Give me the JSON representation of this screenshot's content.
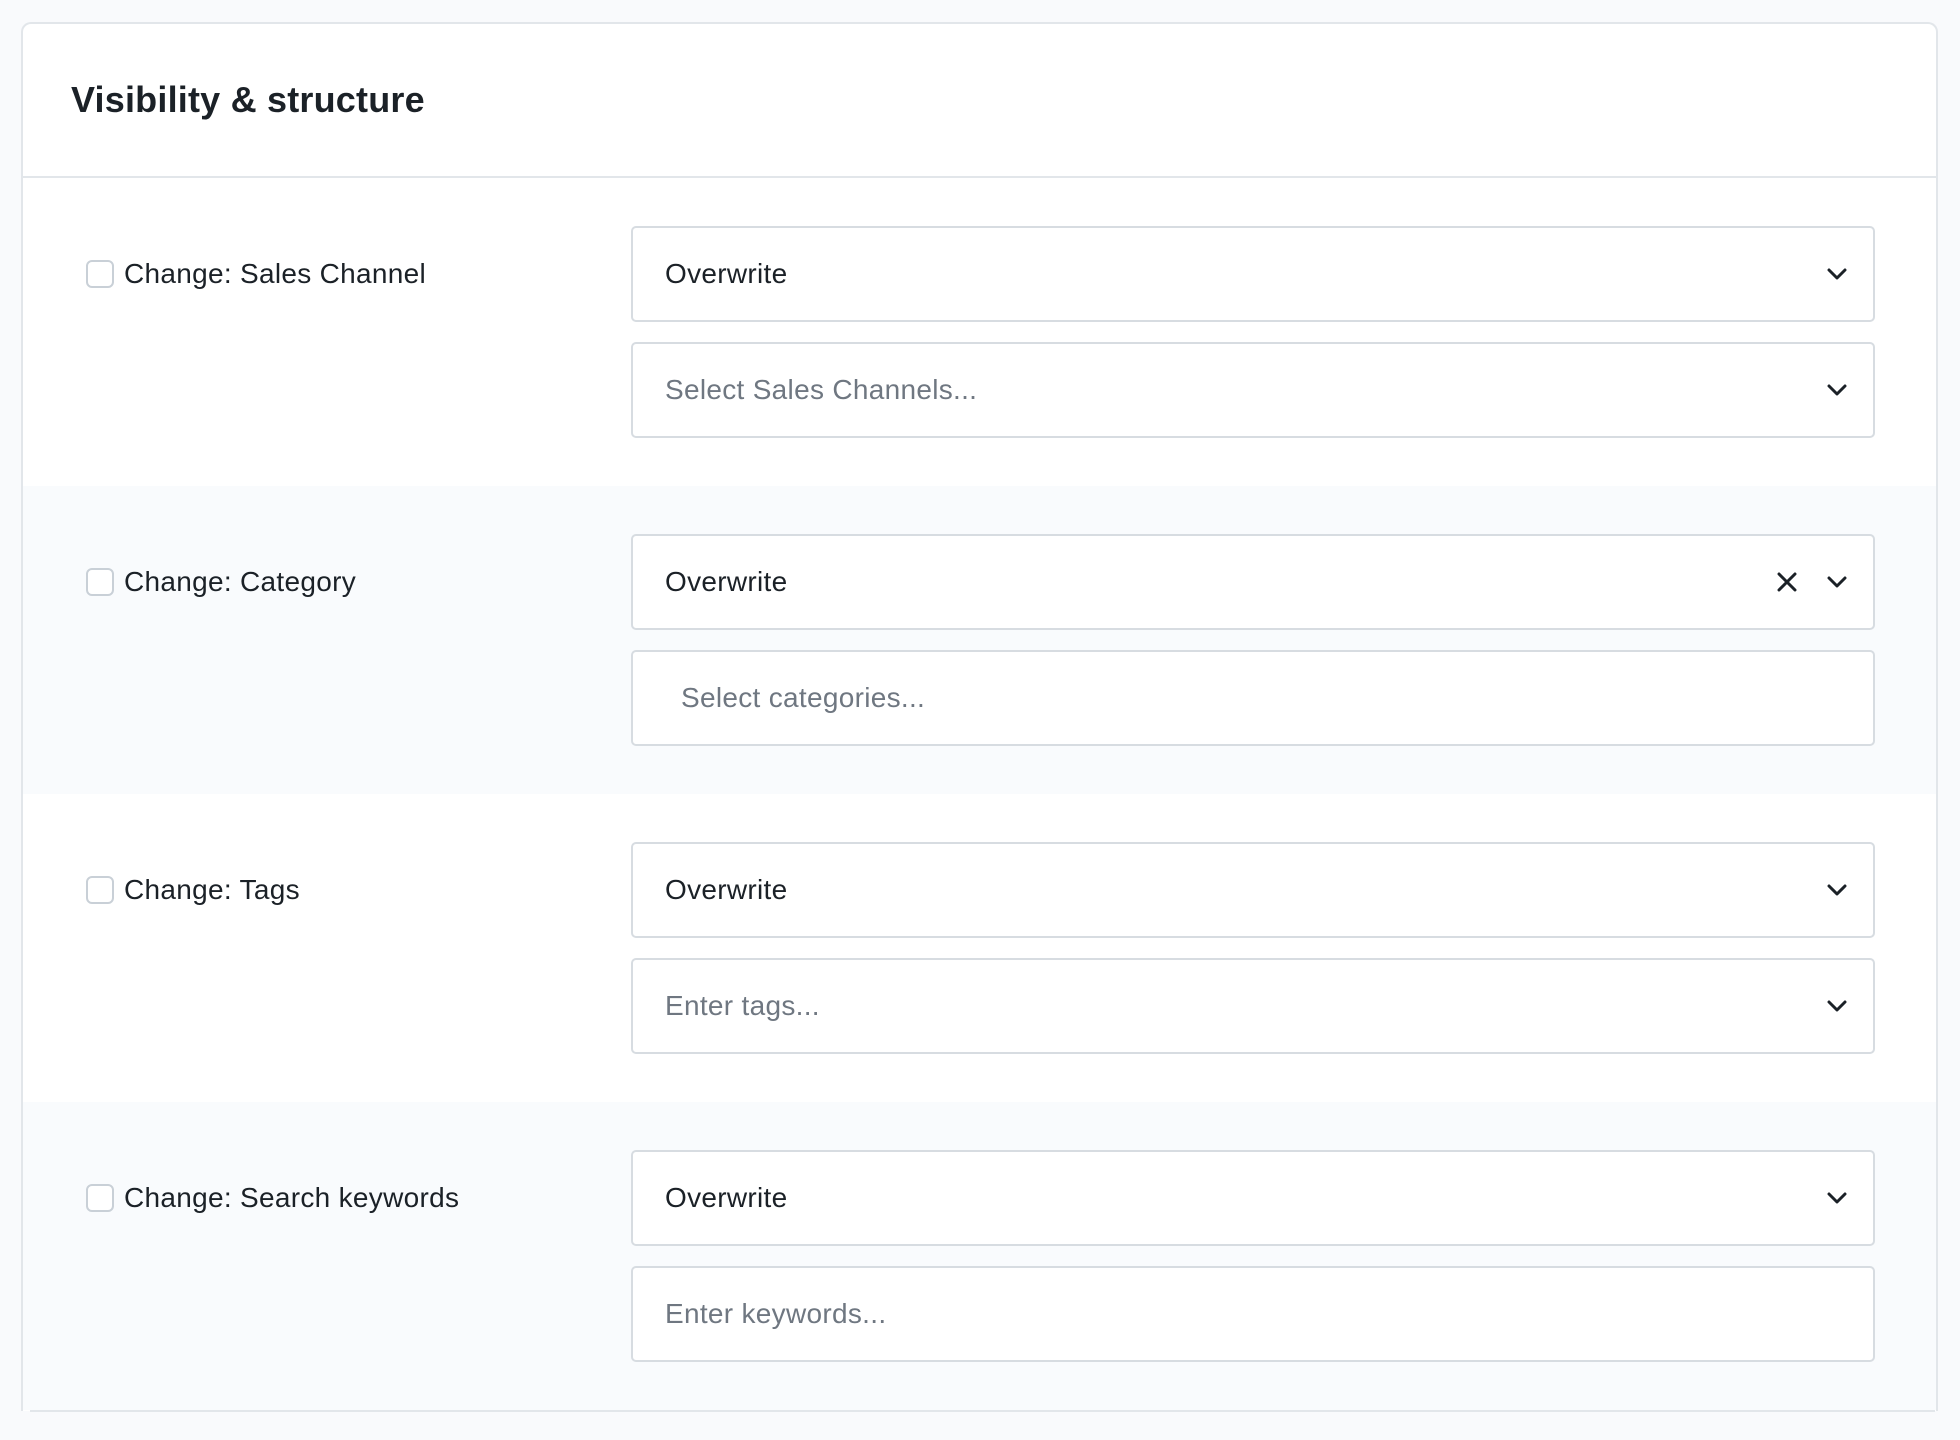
{
  "card": {
    "title": "Visibility & structure"
  },
  "rows": [
    {
      "label": "Change: Sales Channel",
      "mode_value": "Overwrite",
      "input_placeholder": "Select Sales Channels..."
    },
    {
      "label": "Change: Category",
      "mode_value": "Overwrite",
      "input_placeholder": "Select categories..."
    },
    {
      "label": "Change: Tags",
      "mode_value": "Overwrite",
      "input_placeholder": "Enter tags..."
    },
    {
      "label": "Change: Search keywords",
      "mode_value": "Overwrite",
      "input_placeholder": "Enter keywords..."
    }
  ],
  "icons": {
    "dropdown": "chevron-down-icon",
    "clear": "close-icon"
  },
  "colors": {
    "page_background": "#f9fafc",
    "card_background": "#ffffff",
    "alt_row_background": "#f9fbfd",
    "border": "#d7dce1",
    "text": "#1b2127",
    "placeholder": "#6f7781"
  }
}
